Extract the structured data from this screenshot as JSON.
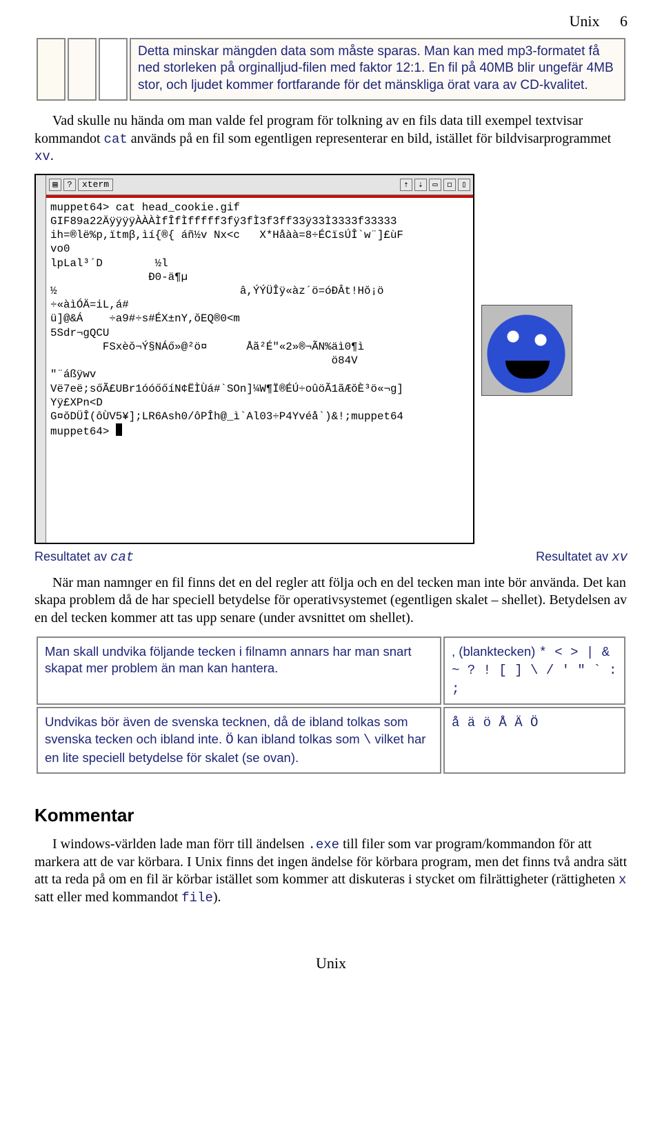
{
  "header": {
    "title": "Unix",
    "page": "6"
  },
  "intro_box": "Detta minskar  mängden data som måste sparas. Man kan med mp3-formatet få ned storleken på orginalljud-filen med faktor 12:1. En fil på 40MB blir ungefär 4MB stor, och ljudet kommer fortfarande för det mänskliga örat vara av CD-kvalitet.",
  "para1": {
    "a": "Vad skulle nu hända om man valde fel program för tolkning av en fils data till exempel textvisar kommandot ",
    "c1": "cat",
    "b": "   används på en fil som egentligen representerar en bild, istället för bildvisarprogrammet ",
    "c2": "xv",
    "c": "."
  },
  "xterm": {
    "label": "xterm",
    "btn_menu": "▤",
    "btn_q": "?",
    "btn_up": "⇡",
    "btn_down": "⇣",
    "btn_sq": "▭",
    "btn_sq2": "◻",
    "btn_pause": "▯",
    "body": "muppet64> cat head_cookie.gif\nGIF89a22ÄÿÿÿÿÀÀÀÌfÎfÌfffff3fÿ3fÌ3f3ff33ÿ33Ì3333f33333\nih=®lë%p,ïtmβ,ìí{®{ áñ½v Nx<c   X*Håàà=8÷ÉCïsÚÎ`w¨]£ùF\nvo0\nlpLal³´D        ½l\n               Ð0-ä¶µ\n½                            â,ÝÝÜÎÿ«àz´ö=óÐÂt!Hŏ¡ö\n÷«àìÓÄ=iL,á#\nü]@&Á    ÷a9#÷s#ÉX±nY,ŏEQ®0<m\n5Sdr¬gQCU\n        FSxèŏ¬Ý§NÁő»@²ö¤      Åã²É\"«2»®¬ÃN%äì0¶ì\n                                           ö84V\n\"¨áßÿwv\nVë7eë;sőÃ£UBr1óóőőíN¢ËÌÙá#`SOn]¼W¶Ï®ÉÚ÷oûöÃ1ãÆŏÈ³ö«¬g]\nYÿ£XPn<D\nG¤ŏDÜÎ(ôÙV5¥];LR6Ash0/ôPÎh@_ì`Al03÷P4Yvéå`)&!;muppet64\nmuppet64> "
  },
  "captions": {
    "left_a": "Resultatet av ",
    "left_c": "cat",
    "right_a": "Resultatet av ",
    "right_c": "xv"
  },
  "para2": "När man namnger en fil finns det en del regler att följa och en del tecken man inte bör använda. Det kan skapa problem då de har speciell betydelse för operativsystemet (egentligen skalet – shellet). Betydelsen av en del tecken kommer att tas upp senare (under avsnittet om shellet).",
  "table": {
    "r1_left": "Man skall undvika följande tecken i filnamn annars har man snart skapat mer problem än man kan hantera.",
    "r1_right_a": ", (blanktecken) ",
    "r1_right_b": "* < > | & ~  ? ! [ ] \\ / ' \" ` : ;",
    "r2_left_a": "Undvikas bör även de svenska tecknen, då de ibland tolkas som svenska tecken och ibland inte. ",
    "r2_left_b": "Ö",
    "r2_left_c": " kan ibland tolkas som ",
    "r2_left_d": "\\",
    "r2_left_e": " vilket har en lite speciell betydelse för skalet (se ovan).",
    "r2_right": "å ä ö Å Ä Ö"
  },
  "kommentar": {
    "heading": "Kommentar",
    "a": "I windows-världen lade man förr till ändelsen ",
    "c1": ".exe",
    "b": " till filer som var program/kommandon för att markera att de var körbara. I Unix finns det ingen ändelse för körbara program, men det finns två andra sätt att ta reda på om en fil är körbar istället som kommer att diskuteras i stycket om filrättigheter (rättigheten ",
    "c2": "x",
    "c": " satt eller med kommandot ",
    "c3": "file",
    "d": ")."
  },
  "footer": "Unix"
}
